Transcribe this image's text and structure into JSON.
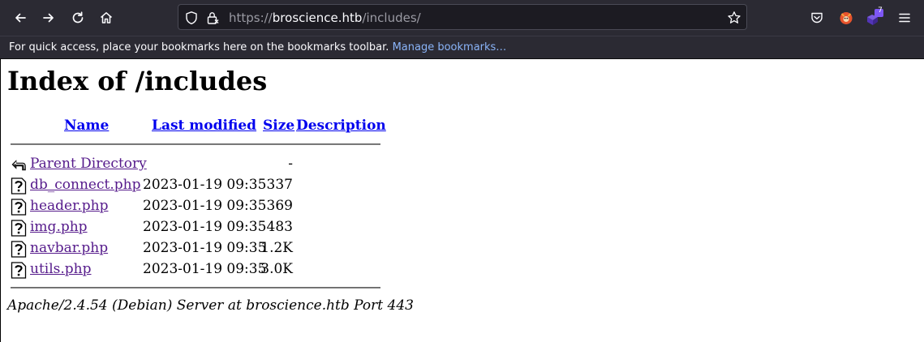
{
  "browser": {
    "url": {
      "protocol": "https://",
      "host": "broscience.htb",
      "path": "/includes/"
    },
    "extension_badge": "7",
    "bookmarks_toolbar": {
      "message": "For quick access, place your bookmarks here on the bookmarks toolbar.",
      "manage_link": "Manage bookmarks…"
    },
    "icons": {
      "back": "back-arrow-icon",
      "forward": "forward-arrow-icon",
      "reload": "reload-icon",
      "home": "home-icon",
      "tracking": "shield-icon",
      "lock": "lock-icon",
      "bookmark_star": "star-icon",
      "pocket": "pocket-icon",
      "ext1": "foxyproxy-icon",
      "ext2": "extension-badge-icon",
      "menu": "hamburger-menu-icon"
    }
  },
  "page": {
    "title": "Index of /includes",
    "columns": {
      "name": "Name",
      "last_modified": "Last modified",
      "size": "Size",
      "description": "Description"
    },
    "rows": [
      {
        "name": "Parent Directory",
        "date": "",
        "size": "-",
        "icon": "parent-directory-icon"
      },
      {
        "name": "db_connect.php",
        "date": "2023-01-19 09:35",
        "size": "337",
        "icon": "unknown-file-icon"
      },
      {
        "name": "header.php",
        "date": "2023-01-19 09:35",
        "size": "369",
        "icon": "unknown-file-icon"
      },
      {
        "name": "img.php",
        "date": "2023-01-19 09:35",
        "size": "483",
        "icon": "unknown-file-icon"
      },
      {
        "name": "navbar.php",
        "date": "2023-01-19 09:35",
        "size": "1.2K",
        "icon": "unknown-file-icon"
      },
      {
        "name": "utils.php",
        "date": "2023-01-19 09:35",
        "size": "3.0K",
        "icon": "unknown-file-icon"
      }
    ],
    "address": "Apache/2.4.54 (Debian) Server at broscience.htb Port 443"
  },
  "colors": {
    "chrome_bg": "#2b2a33",
    "urlbar_bg": "#1c1b22",
    "link_visited": "#551a8b",
    "link": "#0000ee",
    "bookmark_link": "#8ab4f8"
  }
}
